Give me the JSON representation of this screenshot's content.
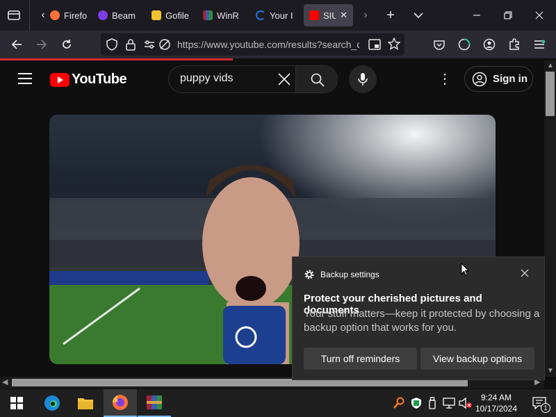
{
  "browser": {
    "tabs": [
      {
        "label": "Firefo",
        "color": "#ff7139"
      },
      {
        "label": "Beam",
        "color": "#7b3fe4"
      },
      {
        "label": "Gofile",
        "color": "#f2c230"
      },
      {
        "label": "WinR",
        "color": "#a0243a"
      },
      {
        "label": "Your I",
        "color": "#1a73e8"
      },
      {
        "label": "SIU",
        "color": "#ff0000"
      }
    ],
    "url": "https://www.youtube.com/results?search_q",
    "accent": "#d42a2a"
  },
  "youtube": {
    "logo_text": "YouTube",
    "search_query": "puppy vids",
    "signin_label": "Sign in"
  },
  "toast": {
    "app_name": "Backup settings",
    "title": "Protect your cherished pictures and documents",
    "body": "Your stuff matters—keep it protected by choosing a backup option that works for you.",
    "button_primary": "Turn off reminders",
    "button_secondary": "View backup options"
  },
  "taskbar": {
    "time": "9:24 AM",
    "date": "10/17/2024",
    "notification_count": "1"
  }
}
